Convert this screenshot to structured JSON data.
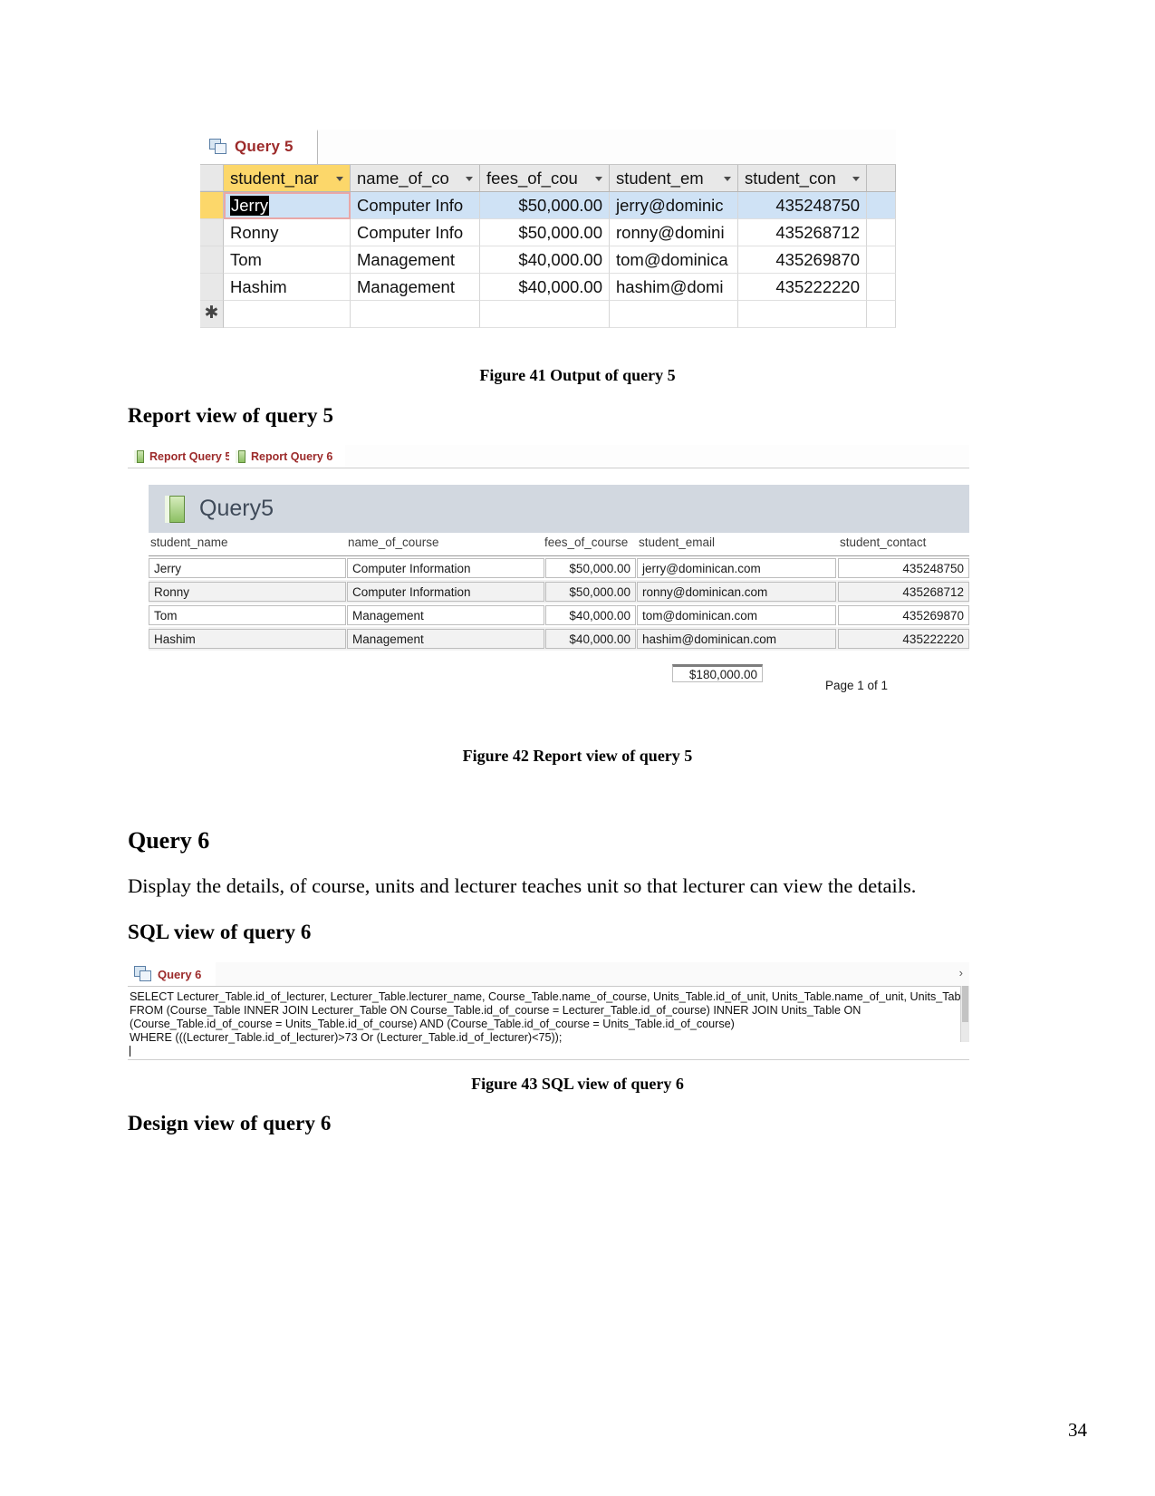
{
  "document": {
    "page_number": "34",
    "headings": {
      "report_view_q5": "Report view of query 5",
      "query6": "Query 6",
      "sql_view_q6": "SQL view of query 6",
      "design_view_q6": "Design view of query 6"
    },
    "paragraphs": {
      "query6_desc": "Display the details, of course, units and lecturer teaches unit so that lecturer can view the details."
    },
    "captions": {
      "figure41": "Figure 41 Output of query 5",
      "figure42": "Figure 42 Report view of query 5",
      "figure43": "Figure 43 SQL view of query 6"
    }
  },
  "figure41_datasheet": {
    "tab": {
      "label": "Query 5",
      "icon": "query-icon"
    },
    "columns": [
      {
        "label": "student_nar",
        "highlighted": true
      },
      {
        "label": "name_of_co",
        "highlighted": false
      },
      {
        "label": "fees_of_cou",
        "highlighted": false
      },
      {
        "label": "student_em",
        "highlighted": false
      },
      {
        "label": "student_con",
        "highlighted": false
      }
    ],
    "rows": [
      {
        "selected": true,
        "editing": true,
        "student_name": "Jerry",
        "name_of_course": "Computer Info",
        "fees_of_course": "$50,000.00",
        "student_email": "jerry@dominic",
        "student_contact": "435248750"
      },
      {
        "selected": false,
        "editing": false,
        "student_name": "Ronny",
        "name_of_course": "Computer Info",
        "fees_of_course": "$50,000.00",
        "student_email": "ronny@domini",
        "student_contact": "435268712"
      },
      {
        "selected": false,
        "editing": false,
        "student_name": "Tom",
        "name_of_course": "Management",
        "fees_of_course": "$40,000.00",
        "student_email": "tom@dominica",
        "student_contact": "435269870"
      },
      {
        "selected": false,
        "editing": false,
        "student_name": "Hashim",
        "name_of_course": "Management",
        "fees_of_course": "$40,000.00",
        "student_email": "hashim@domi",
        "student_contact": "435222220"
      }
    ],
    "new_record_marker": "✱"
  },
  "figure42_report": {
    "tabs": [
      {
        "label": "Report Query 5",
        "icon": "report-icon",
        "active": true
      },
      {
        "label": "Report Query 6",
        "icon": "report-icon",
        "active": false
      }
    ],
    "title": "Query5",
    "title_icon": "report-icon",
    "columns": [
      "student_name",
      "name_of_course",
      "fees_of_course",
      "student_email",
      "student_contact"
    ],
    "rows": [
      {
        "student_name": "Jerry",
        "name_of_course": "Computer Information",
        "fees_of_course": "$50,000.00",
        "student_email": "jerry@dominican.com",
        "student_contact": "435248750"
      },
      {
        "student_name": "Ronny",
        "name_of_course": "Computer Information",
        "fees_of_course": "$50,000.00",
        "student_email": "ronny@dominican.com",
        "student_contact": "435268712"
      },
      {
        "student_name": "Tom",
        "name_of_course": "Management",
        "fees_of_course": "$40,000.00",
        "student_email": "tom@dominican.com",
        "student_contact": "435269870"
      },
      {
        "student_name": "Hashim",
        "name_of_course": "Management",
        "fees_of_course": "$40,000.00",
        "student_email": "hashim@dominican.com",
        "student_contact": "435222220"
      }
    ],
    "total": "$180,000.00",
    "page_footer": "Page 1 of 1"
  },
  "figure43_sql": {
    "tab": {
      "label": "Query 6",
      "icon": "query-icon"
    },
    "chevron": "›",
    "lines": [
      "SELECT Lecturer_Table.id_of_lecturer, Lecturer_Table.lecturer_name, Course_Table.name_of_course, Units_Table.id_of_unit, Units_Table.name_of_unit, Units_Table.level_",
      "FROM (Course_Table INNER JOIN Lecturer_Table ON Course_Table.id_of_course = Lecturer_Table.id_of_course) INNER JOIN Units_Table ON",
      "(Course_Table.id_of_course = Units_Table.id_of_course) AND (Course_Table.id_of_course = Units_Table.id_of_course)",
      "WHERE (((Lecturer_Table.id_of_lecturer)>73 Or (Lecturer_Table.id_of_lecturer)<75));"
    ]
  }
}
